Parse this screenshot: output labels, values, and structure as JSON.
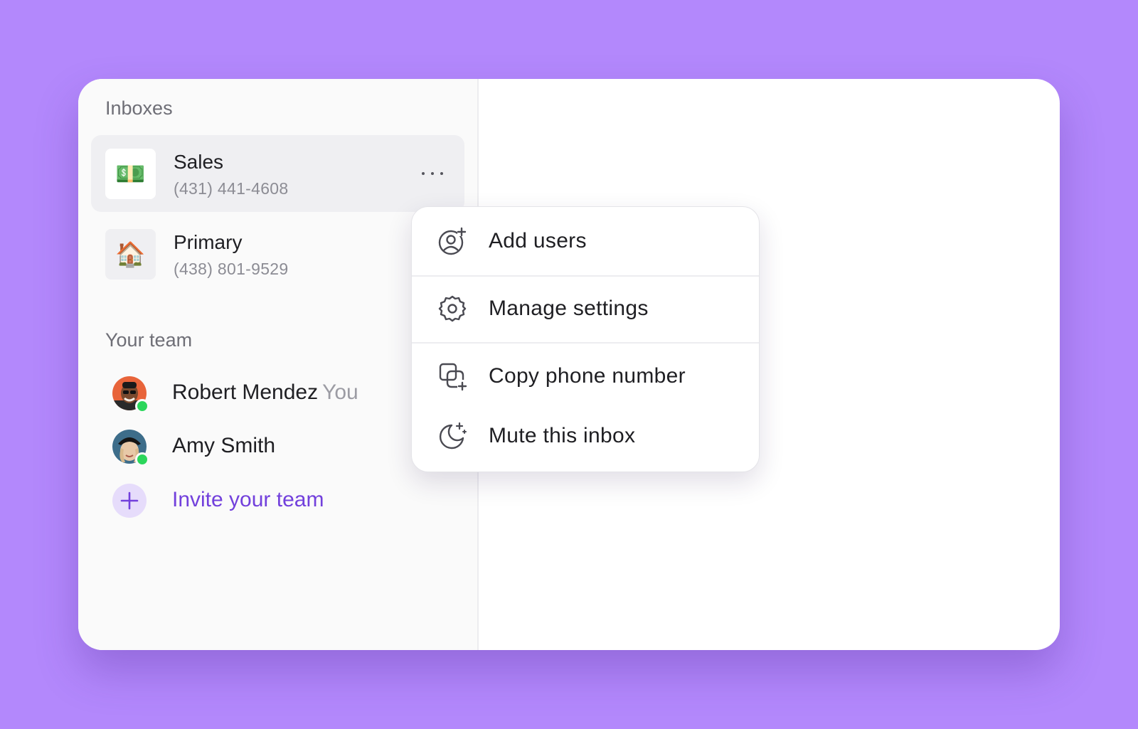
{
  "sidebar": {
    "inboxes_title": "Inboxes",
    "inboxes": [
      {
        "name": "Sales",
        "phone": "(431) 441-4608",
        "icon": "💵",
        "selected": true
      },
      {
        "name": "Primary",
        "phone": "(438) 801-9529",
        "icon": "🏠",
        "selected": false
      }
    ],
    "team_title": "Your team",
    "team": [
      {
        "name": "Robert Mendez",
        "tag": "You",
        "online": true
      },
      {
        "name": "Amy Smith",
        "tag": "",
        "online": true
      }
    ],
    "invite_label": "Invite your team"
  },
  "menu": {
    "items": [
      {
        "label": "Add users",
        "icon": "add-user-icon"
      },
      {
        "label": "Manage settings",
        "icon": "gear-icon"
      },
      {
        "label": "Copy phone number",
        "icon": "copy-icon"
      },
      {
        "label": "Mute this inbox",
        "icon": "moon-icon"
      }
    ]
  },
  "colors": {
    "background": "#b388fc",
    "accent": "#7240dc",
    "online": "#2bd65b"
  }
}
